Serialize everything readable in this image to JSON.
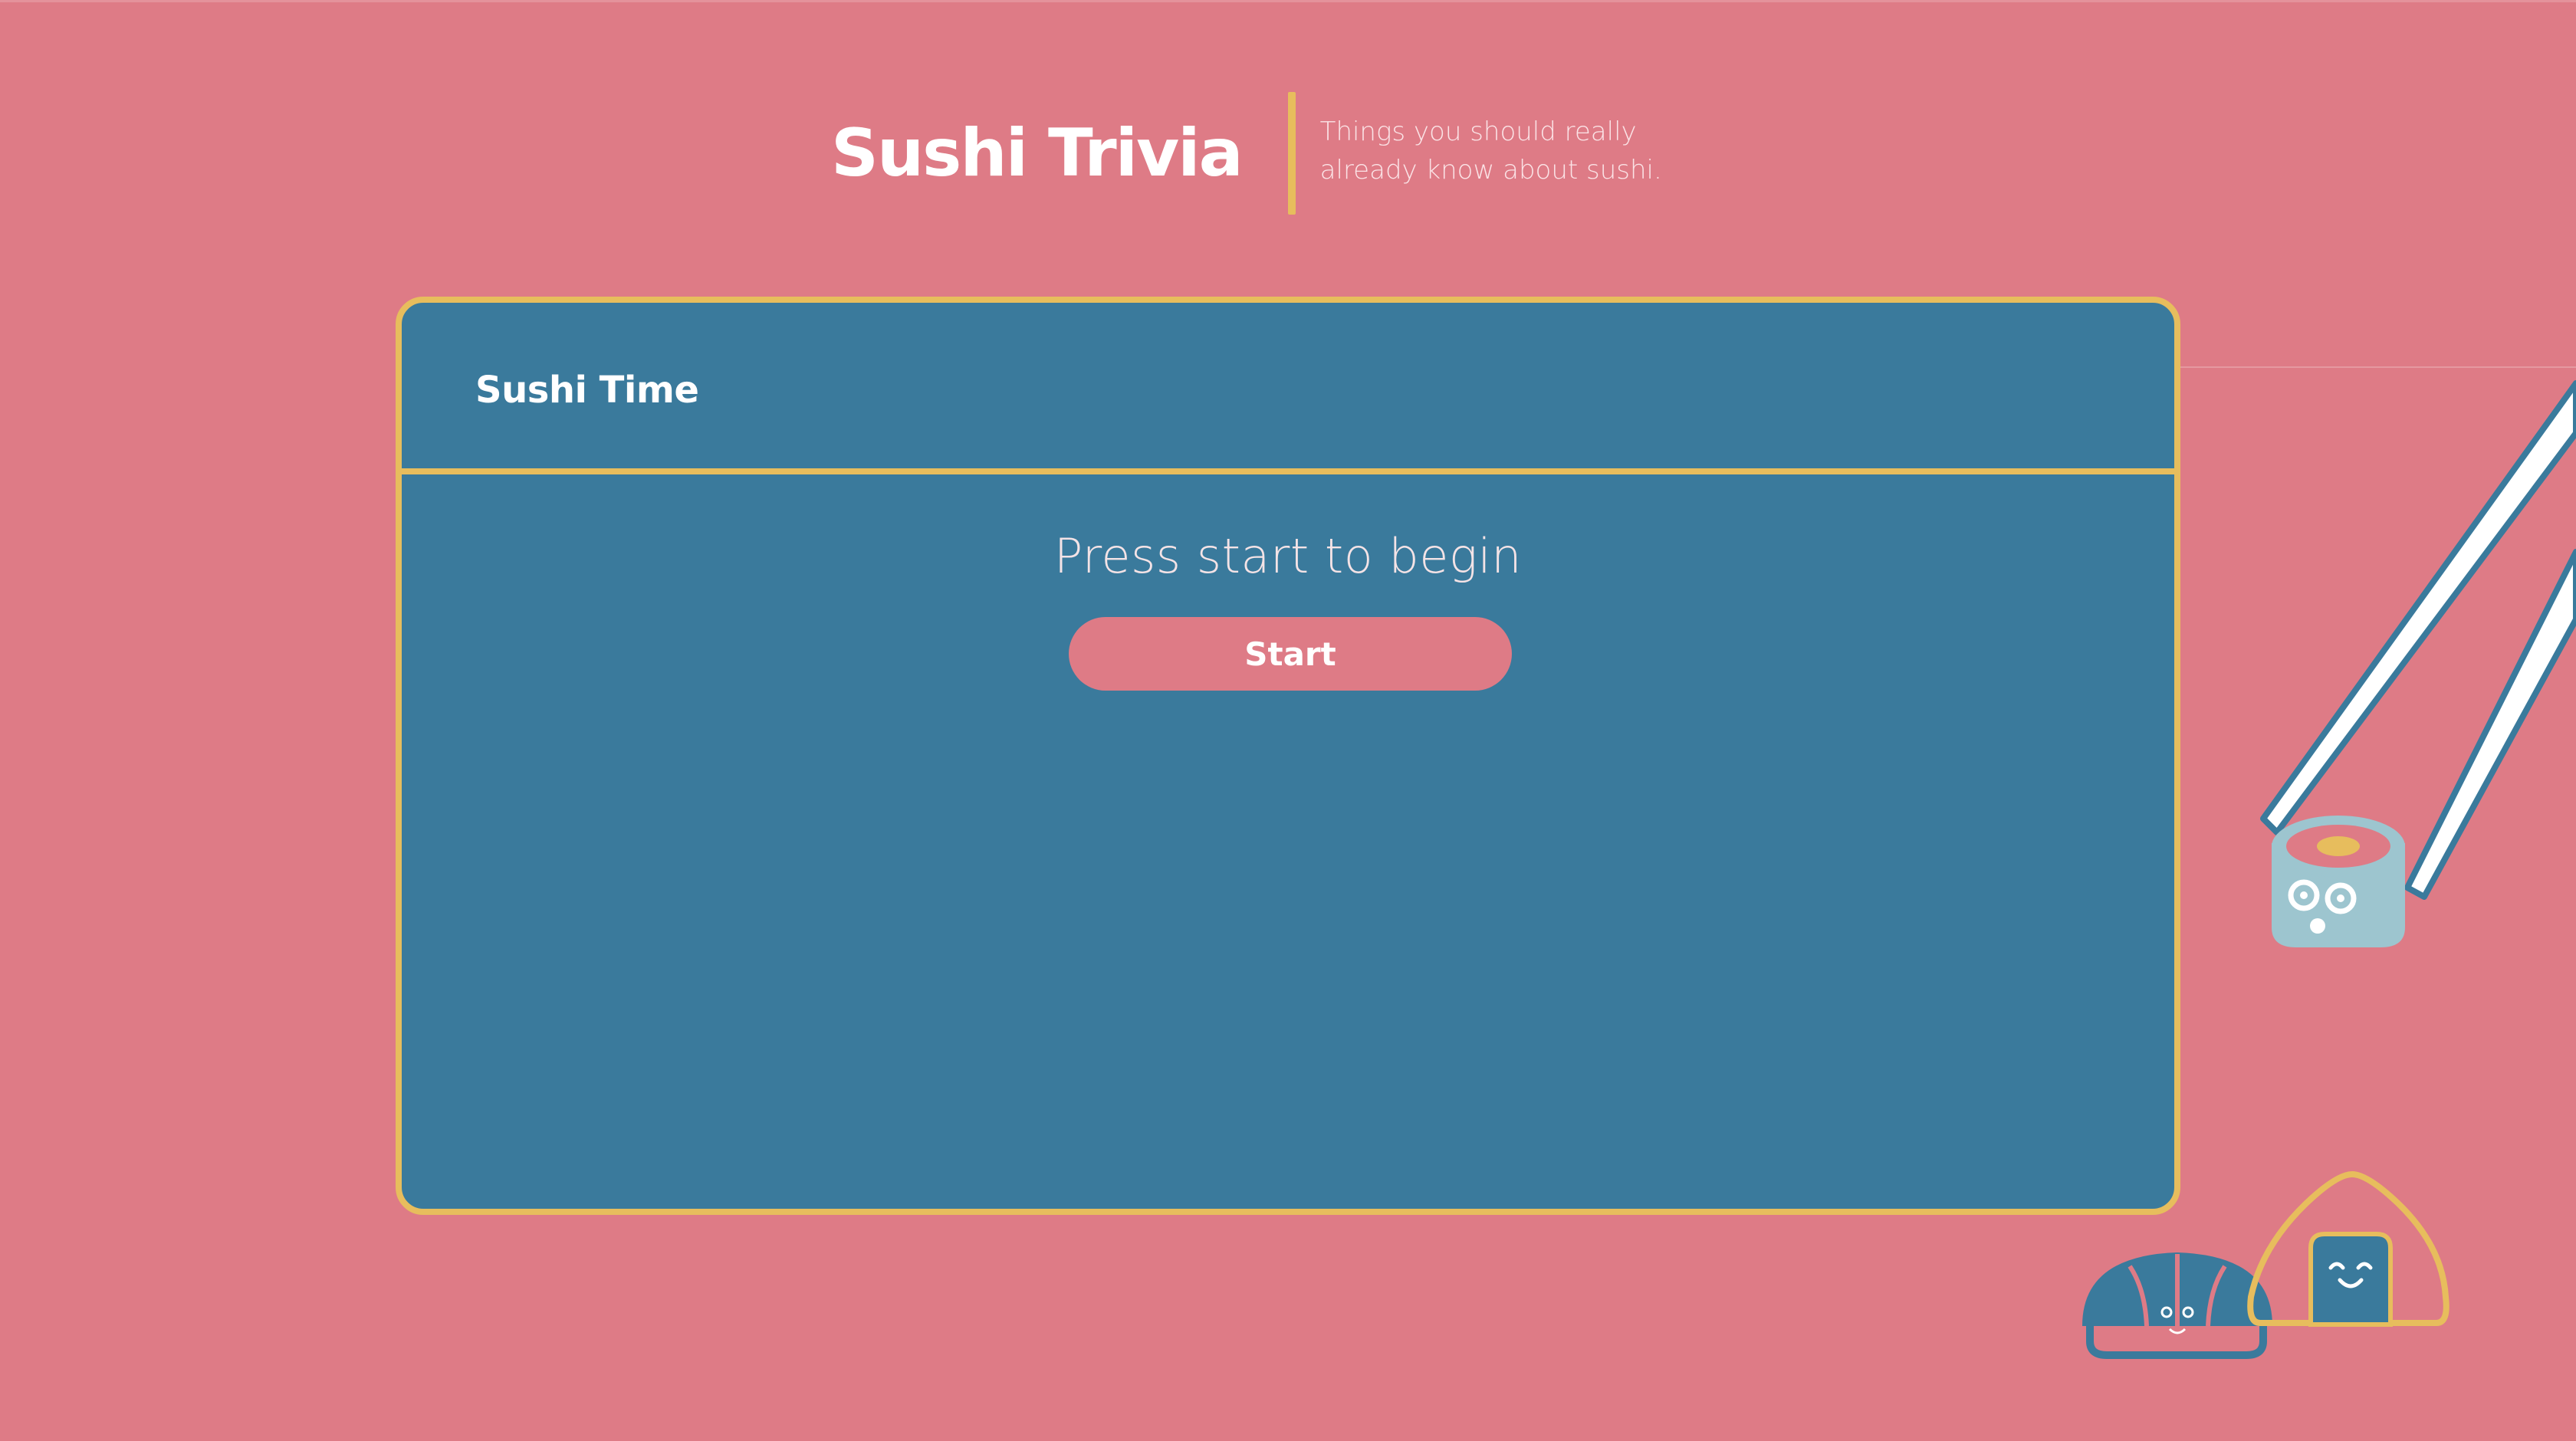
{
  "header": {
    "title": "Sushi Trivia",
    "subtitle": "Things you should really already know about sushi."
  },
  "card": {
    "title": "Sushi Time",
    "prompt": "Press start to begin",
    "start_label": "Start"
  },
  "colors": {
    "background": "#de7b86",
    "card": "#3a7a9c",
    "accent_yellow": "#e7bd5d",
    "button": "#de7b86",
    "text": "#ffffff"
  },
  "illustrations": [
    "chopsticks-icon",
    "sushi-roll-icon",
    "nigiri-icon",
    "onigiri-icon"
  ]
}
